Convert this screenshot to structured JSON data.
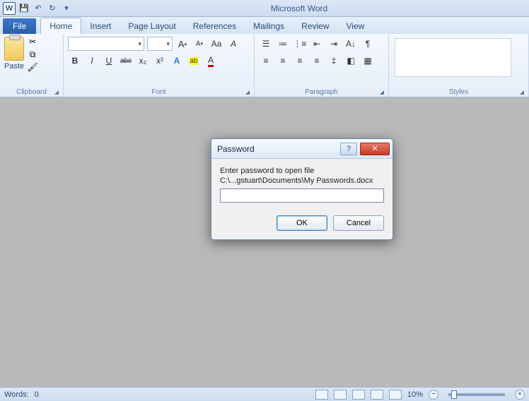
{
  "app": {
    "title": "Microsoft Word",
    "icon_letter": "W"
  },
  "qat": {
    "save": "💾",
    "undo": "↶",
    "redo": "↻"
  },
  "tabs": {
    "file": "File",
    "items": [
      "Home",
      "Insert",
      "Page Layout",
      "References",
      "Mailings",
      "Review",
      "View"
    ],
    "active": 0
  },
  "ribbon": {
    "clipboard": {
      "label": "Clipboard",
      "paste": "Paste"
    },
    "font": {
      "label": "Font",
      "name": "",
      "size": "",
      "grow": "A",
      "shrink": "A",
      "case": "Aa",
      "clear": "⌫",
      "bold": "B",
      "italic": "I",
      "underline": "U",
      "strike": "abc",
      "sub": "x₂",
      "sup": "x²",
      "effects": "A",
      "highlight": "ab",
      "color": "A"
    },
    "paragraph": {
      "label": "Paragraph",
      "bullets": "•",
      "numbers": "1",
      "multilevel": "≣",
      "dedent": "⇤",
      "indent": "⇥",
      "sort": "A↓",
      "marks": "¶",
      "left": "≡",
      "center": "≡",
      "right": "≡",
      "justify": "≡",
      "spacing": "‡",
      "shading": "◧",
      "borders": "▦"
    },
    "styles": {
      "label": "Styles"
    }
  },
  "status": {
    "words_label": "Words:",
    "words": "0",
    "zoom": "10%"
  },
  "dialog": {
    "title": "Password",
    "prompt1": "Enter password to open file",
    "prompt2": "C:\\...gstuart\\Documents\\My Passwords.docx",
    "value": "",
    "ok": "OK",
    "cancel": "Cancel"
  }
}
